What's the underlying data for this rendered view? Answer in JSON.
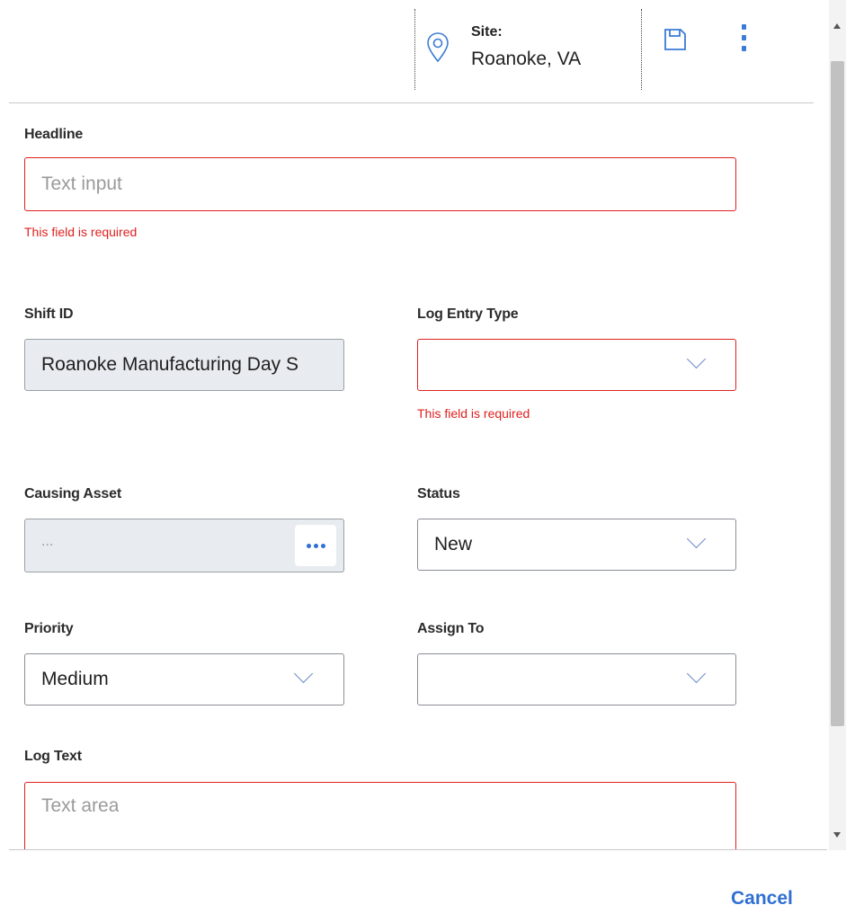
{
  "header": {
    "site_label": "Site:",
    "site_value": "Roanoke, VA",
    "icons": [
      "location-pin-icon",
      "save-icon",
      "more-vertical-icon"
    ]
  },
  "form": {
    "headline": {
      "label": "Headline",
      "placeholder": "Text input",
      "error": "This field is required"
    },
    "shift_id": {
      "label": "Shift ID",
      "value": "Roanoke Manufacturing Day S"
    },
    "log_entry_type": {
      "label": "Log Entry Type",
      "value": "",
      "error": "This field is required"
    },
    "causing_asset": {
      "label": "Causing Asset",
      "value": "..."
    },
    "status": {
      "label": "Status",
      "value": "New"
    },
    "priority": {
      "label": "Priority",
      "value": "Medium"
    },
    "assign_to": {
      "label": "Assign To",
      "value": ""
    },
    "log_text": {
      "label": "Log Text",
      "placeholder": "Text area"
    }
  },
  "footer": {
    "cancel_label": "Cancel"
  },
  "colors": {
    "accent": "#2f6fd3",
    "error": "#e02020",
    "disabled_bg": "#e8ebef"
  }
}
